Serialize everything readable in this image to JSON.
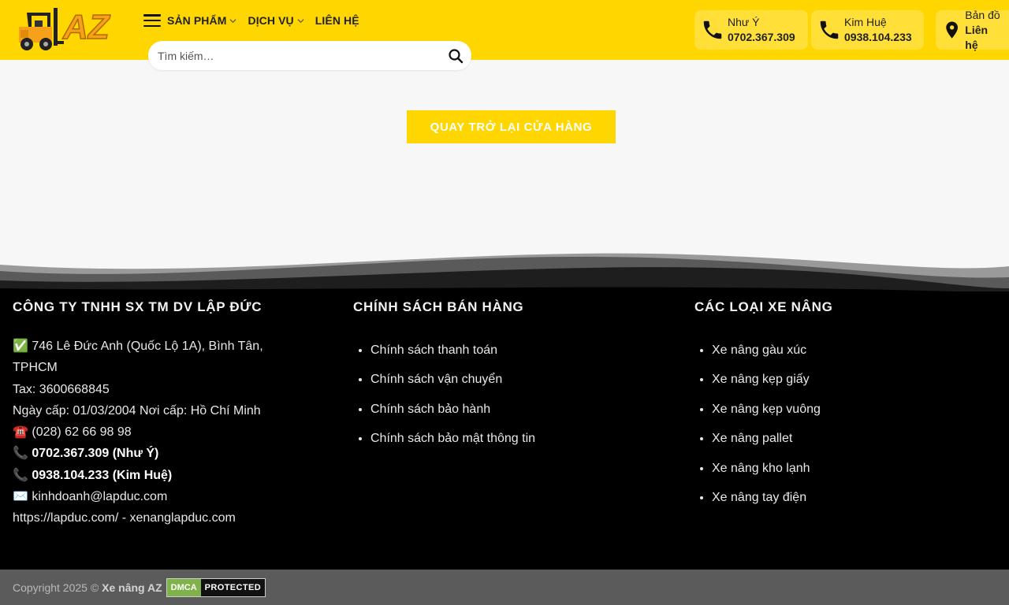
{
  "header": {
    "logo_text": "AZ",
    "nav": [
      {
        "label": "SẢN PHẨM",
        "has_dropdown": true
      },
      {
        "label": "DỊCH VỤ",
        "has_dropdown": true
      },
      {
        "label": "LIÊN HỆ",
        "has_dropdown": false
      }
    ],
    "search_placeholder": "Tìm kiếm…",
    "contacts": [
      {
        "name": "Như Ý",
        "phone": "0702.367.309",
        "icon": "phone-icon"
      },
      {
        "name": "Kim Huệ",
        "phone": "0938.104.233",
        "icon": "phone-icon"
      },
      {
        "name": "Bản đồ",
        "phone": "Liên hệ",
        "icon": "map-pin-icon"
      }
    ]
  },
  "main": {
    "return_button": "QUAY TRỞ LẠI CỬA HÀNG"
  },
  "footer": {
    "col1": {
      "title": "CÔNG TY TNHH SX TM DV LẬP ĐỨC",
      "address_prefix": "✅",
      "address": "746 Lê Đức Anh (Quốc Lộ 1A), Bình Tân, TPHCM",
      "tax": "Tax: 3600668845",
      "issued": "Ngày cấp: 01/03/2004 Nơi cấp: Hồ Chí Minh",
      "tel_prefix": "☎️",
      "tel": "(028) 62 66 98 98",
      "phone_prefix": "📞",
      "phone1": "0702.367.309 (Như Ý)",
      "phone2": "0938.104.233 (Kim Huệ)",
      "email_prefix": "✉️",
      "email": "kinhdoanh@lapduc.com",
      "website": "https://lapduc.com/ - xenanglapduc.com"
    },
    "col2": {
      "title": "CHÍNH SÁCH BÁN HÀNG",
      "items": [
        "Chính sách thanh toán",
        "Chính sách vận chuyển",
        "Chính sách bảo hành",
        "Chính sách bảo mật thông tin"
      ]
    },
    "col3": {
      "title": "CÁC LOẠI XE NÂNG",
      "items": [
        "Xe nâng gàu xúc",
        "Xe nâng kẹp giấy",
        "Xe nâng kẹp vuông",
        "Xe nâng pallet",
        "Xe nâng kho lạnh",
        "Xe nâng tay điện"
      ]
    }
  },
  "copyright": {
    "text": "Copyright 2025 ©",
    "brand": "Xe nâng AZ",
    "dmca_left": "DMCA",
    "dmca_right": "PROTECTED"
  },
  "colors": {
    "brand_yellow": "#ffd600",
    "footer_bg": "#000000",
    "copyright_bg": "#5b5b5b"
  }
}
